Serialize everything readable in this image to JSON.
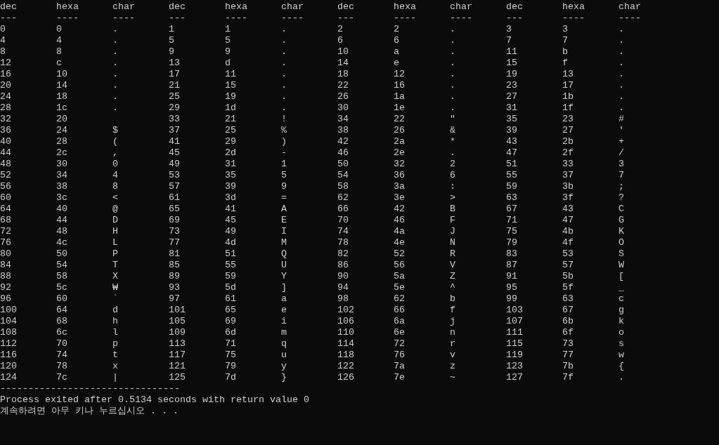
{
  "columns": [
    {
      "label": "dec",
      "rule": "---"
    },
    {
      "label": "hexa",
      "rule": "----"
    },
    {
      "label": "char",
      "rule": "----"
    },
    {
      "label": "dec",
      "rule": "---"
    },
    {
      "label": "hexa",
      "rule": "----"
    },
    {
      "label": "char",
      "rule": "----"
    },
    {
      "label": "dec",
      "rule": "---"
    },
    {
      "label": "hexa",
      "rule": "----"
    },
    {
      "label": "char",
      "rule": "----"
    },
    {
      "label": "dec",
      "rule": "---"
    },
    {
      "label": "hexa",
      "rule": "----"
    },
    {
      "label": "char",
      "rule": "----"
    }
  ],
  "rows": [
    [
      "0",
      "0",
      ".",
      "1",
      "1",
      ".",
      "2",
      "2",
      ".",
      "3",
      "3",
      "."
    ],
    [
      "4",
      "4",
      ".",
      "5",
      "5",
      ".",
      "6",
      "6",
      ".",
      "7",
      "7",
      "."
    ],
    [
      "8",
      "8",
      ".",
      "9",
      "9",
      ".",
      "10",
      "a",
      ".",
      "11",
      "b",
      "."
    ],
    [
      "12",
      "c",
      ".",
      "13",
      "d",
      ".",
      "14",
      "e",
      ".",
      "15",
      "f",
      "."
    ],
    [
      "16",
      "10",
      ".",
      "17",
      "11",
      ".",
      "18",
      "12",
      ".",
      "19",
      "13",
      "."
    ],
    [
      "20",
      "14",
      ".",
      "21",
      "15",
      ".",
      "22",
      "16",
      ".",
      "23",
      "17",
      "."
    ],
    [
      "24",
      "18",
      ".",
      "25",
      "19",
      ".",
      "26",
      "1a",
      ".",
      "27",
      "1b",
      "."
    ],
    [
      "28",
      "1c",
      ".",
      "29",
      "1d",
      ".",
      "30",
      "1e",
      ".",
      "31",
      "1f",
      "."
    ],
    [
      "32",
      "20",
      null,
      "33",
      "21",
      "!",
      "34",
      "22",
      "\"",
      "35",
      "23",
      "#"
    ],
    [
      "36",
      "24",
      "$",
      "37",
      "25",
      "%",
      "38",
      "26",
      "&",
      "39",
      "27",
      "'"
    ],
    [
      "40",
      "28",
      "(",
      "41",
      "29",
      ")",
      "42",
      "2a",
      "*",
      "43",
      "2b",
      "+"
    ],
    [
      "44",
      "2c",
      ",",
      "45",
      "2d",
      "-",
      "46",
      "2e",
      ".",
      "47",
      "2f",
      "/"
    ],
    [
      "48",
      "30",
      "0",
      "49",
      "31",
      "1",
      "50",
      "32",
      "2",
      "51",
      "33",
      "3"
    ],
    [
      "52",
      "34",
      "4",
      "53",
      "35",
      "5",
      "54",
      "36",
      "6",
      "55",
      "37",
      "7"
    ],
    [
      "56",
      "38",
      "8",
      "57",
      "39",
      "9",
      "58",
      "3a",
      ":",
      "59",
      "3b",
      ";"
    ],
    [
      "60",
      "3c",
      "<",
      "61",
      "3d",
      "=",
      "62",
      "3e",
      ">",
      "63",
      "3f",
      "?"
    ],
    [
      "64",
      "40",
      "@",
      "65",
      "41",
      "A",
      "66",
      "42",
      "B",
      "67",
      "43",
      "C"
    ],
    [
      "68",
      "44",
      "D",
      "69",
      "45",
      "E",
      "70",
      "46",
      "F",
      "71",
      "47",
      "G"
    ],
    [
      "72",
      "48",
      "H",
      "73",
      "49",
      "I",
      "74",
      "4a",
      "J",
      "75",
      "4b",
      "K"
    ],
    [
      "76",
      "4c",
      "L",
      "77",
      "4d",
      "M",
      "78",
      "4e",
      "N",
      "79",
      "4f",
      "O"
    ],
    [
      "80",
      "50",
      "P",
      "81",
      "51",
      "Q",
      "82",
      "52",
      "R",
      "83",
      "53",
      "S"
    ],
    [
      "84",
      "54",
      "T",
      "85",
      "55",
      "U",
      "86",
      "56",
      "V",
      "87",
      "57",
      "W"
    ],
    [
      "88",
      "58",
      "X",
      "89",
      "59",
      "Y",
      "90",
      "5a",
      "Z",
      "91",
      "5b",
      "["
    ],
    [
      "92",
      "5c",
      "₩",
      "93",
      "5d",
      "]",
      "94",
      "5e",
      "^",
      "95",
      "5f",
      "_"
    ],
    [
      "96",
      "60",
      "`",
      "97",
      "61",
      "a",
      "98",
      "62",
      "b",
      "99",
      "63",
      "c"
    ],
    [
      "100",
      "64",
      "d",
      "101",
      "65",
      "e",
      "102",
      "66",
      "f",
      "103",
      "67",
      "g"
    ],
    [
      "104",
      "68",
      "h",
      "105",
      "69",
      "i",
      "106",
      "6a",
      "j",
      "107",
      "6b",
      "k"
    ],
    [
      "108",
      "6c",
      "l",
      "109",
      "6d",
      "m",
      "110",
      "6e",
      "n",
      "111",
      "6f",
      "o"
    ],
    [
      "112",
      "70",
      "p",
      "113",
      "71",
      "q",
      "114",
      "72",
      "r",
      "115",
      "73",
      "s"
    ],
    [
      "116",
      "74",
      "t",
      "117",
      "75",
      "u",
      "118",
      "76",
      "v",
      "119",
      "77",
      "w"
    ],
    [
      "120",
      "78",
      "x",
      "121",
      "79",
      "y",
      "122",
      "7a",
      "z",
      "123",
      "7b",
      "{"
    ],
    [
      "124",
      "7c",
      "|",
      "125",
      "7d",
      "}",
      "126",
      "7e",
      "~",
      "127",
      "7f",
      "."
    ]
  ],
  "separator": "--------------------------------",
  "output_lines": [
    "Process exited after 0.5134 seconds with return value 0",
    "계속하려면 아무 키나 누르십시오 . . ."
  ]
}
